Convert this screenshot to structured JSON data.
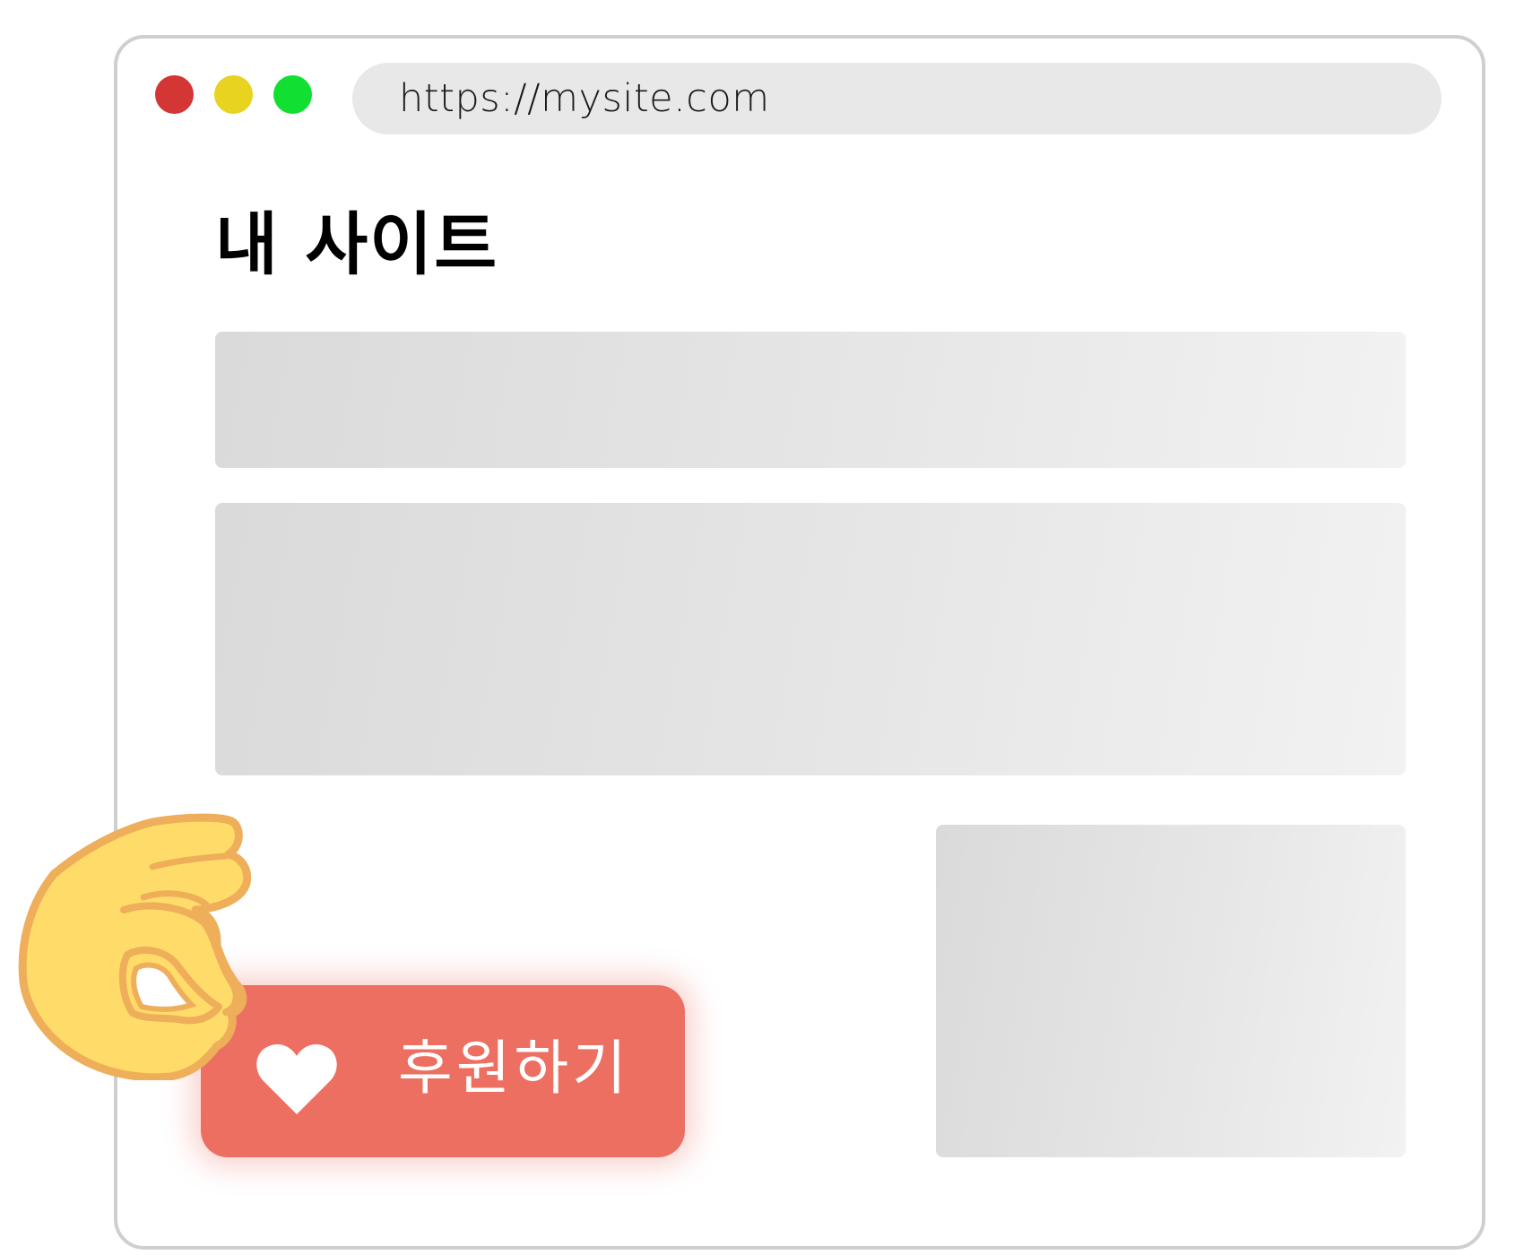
{
  "browser": {
    "url": "https://mysite.com",
    "controls": [
      {
        "name": "close",
        "color": "#d43535"
      },
      {
        "name": "minimize",
        "color": "#e8d321"
      },
      {
        "name": "maximize",
        "color": "#11e033"
      }
    ]
  },
  "page": {
    "title": "내 사이트",
    "placeholder_color": "#e2e2e2"
  },
  "donate_button": {
    "label": "후원하기",
    "icon": "heart-icon",
    "color": "#ec6f62"
  },
  "pointer": {
    "icon": "ok-hand-icon"
  }
}
